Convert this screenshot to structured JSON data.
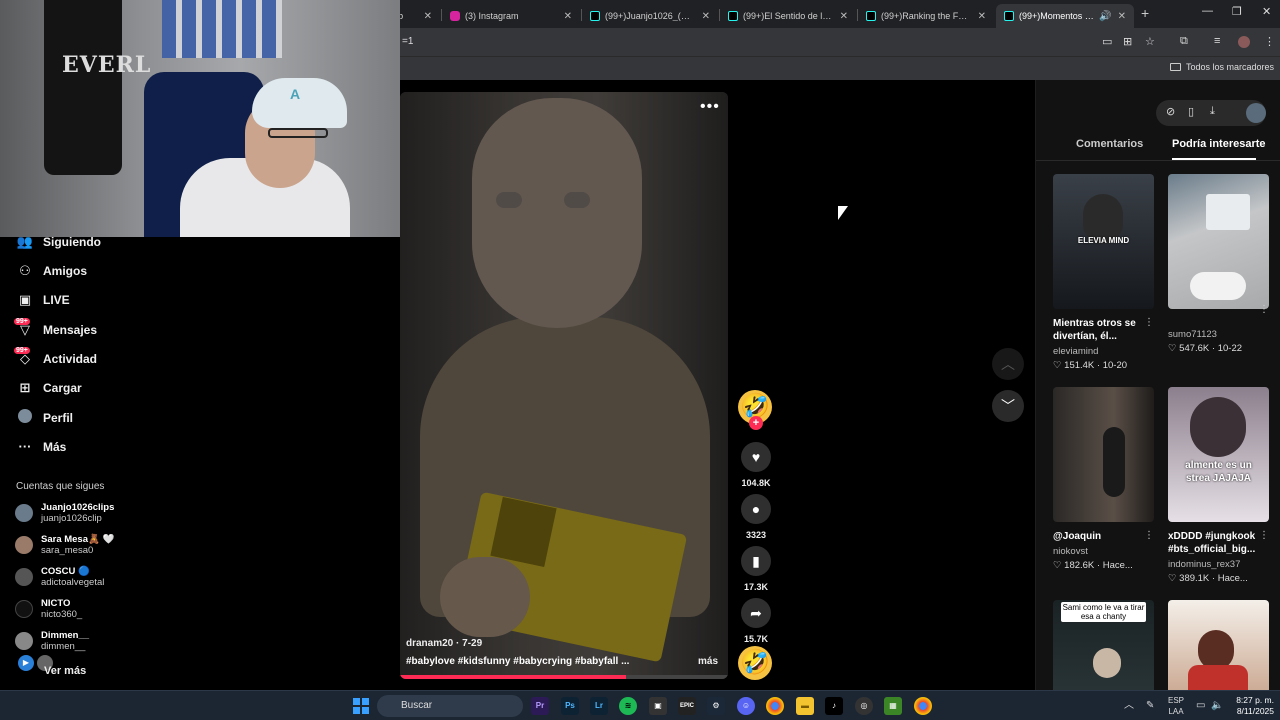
{
  "browser": {
    "tabs": [
      {
        "title": "Tub",
        "favicon_color": "#ff0000"
      },
      {
        "title": "(3) Instagram",
        "favicon_color": "#d6249f"
      },
      {
        "title": "(99+)Juanjo1026_(@juanj",
        "favicon_color": "#000000"
      },
      {
        "title": "(99+)El Sentido de la Vida",
        "favicon_color": "#000000"
      },
      {
        "title": "(99+)Ranking the Funnies",
        "favicon_color": "#000000"
      },
      {
        "title": "(99+)Momentos dive",
        "favicon_color": "#000000"
      }
    ],
    "tab_close_glyph": "✕",
    "new_tab_glyph": "+",
    "window_controls": {
      "minimize": "—",
      "maximize": "❐",
      "close": "✕"
    },
    "url_fragment": "=1",
    "bookmarks_all_label": "Todos los marcadores"
  },
  "left_nav": {
    "items": [
      {
        "label": "Siguiendo",
        "icon": "following-icon"
      },
      {
        "label": "Amigos",
        "icon": "friends-icon"
      },
      {
        "label": "LIVE",
        "icon": "live-icon"
      },
      {
        "label": "Mensajes",
        "icon": "messages-icon",
        "badge": "99+"
      },
      {
        "label": "Actividad",
        "icon": "activity-icon",
        "badge": "99+"
      },
      {
        "label": "Cargar",
        "icon": "upload-icon"
      },
      {
        "label": "Perfil",
        "icon": "profile-icon"
      },
      {
        "label": "Más",
        "icon": "more-icon"
      }
    ],
    "following_title": "Cuentas que sigues",
    "following": [
      {
        "name": "Juanjo1026clips",
        "handle": "juanjo1026clip"
      },
      {
        "name": "Sara Mesa🧸 🤍",
        "handle": "sara_mesa0"
      },
      {
        "name": "COSCU 🔵",
        "handle": "adictoalvegetal"
      },
      {
        "name": "NICTO",
        "handle": "nicto360_"
      },
      {
        "name": "Dimmen__",
        "handle": "dimmen__"
      }
    ],
    "see_more": "Ver más"
  },
  "video": {
    "author_date": "dranam20 · 7-29",
    "hashtags": "#babylove  #kidsfunny  #babycrying  #babyfall ...",
    "more_label": "más",
    "progress": 0.69
  },
  "actions": {
    "likes": "104.8K",
    "comments": "3323",
    "saves": "17.3K",
    "shares": "15.7K"
  },
  "right_panel": {
    "tabs": [
      "Comentarios",
      "Podría interesarte"
    ],
    "active_tab": "Podría interesarte",
    "cards": [
      {
        "title": "Mientras otros se divertían, él...",
        "user": "eleviamind",
        "meta": "♡ 151.4K · 10-20",
        "thumb_text": "ELEVIA MIND",
        "color": "#1b2128"
      },
      {
        "title": "",
        "user": "sumo71123",
        "meta": "♡ 547.6K · 10-22",
        "thumb_text": "",
        "color": "#bfc2c5"
      },
      {
        "title": "@Joaquin",
        "user": "niokovst",
        "meta": "♡ 182.6K · Hace...",
        "thumb_text": "",
        "color": "#3a3430"
      },
      {
        "title": "xDDDD #jungkook #bts_official_big...",
        "user": "indominus_rex37",
        "meta": "♡ 389.1K · Hace...",
        "thumb_text": "almente es un strea JAJAJA",
        "color": "#cfc8cf"
      },
      {
        "title": "",
        "user": "",
        "meta": "",
        "thumb_text": "Sami como le va a tirar esa a chanty",
        "color": "#1f2a2c"
      },
      {
        "title": "",
        "user": "",
        "meta": "",
        "thumb_text": "",
        "color": "#c9a58a"
      }
    ]
  },
  "taskbar": {
    "search_placeholder": "Buscar",
    "lang_top": "ESP",
    "lang_bottom": "LAA",
    "time": "8:27 p. m.",
    "date": "8/11/2025"
  }
}
